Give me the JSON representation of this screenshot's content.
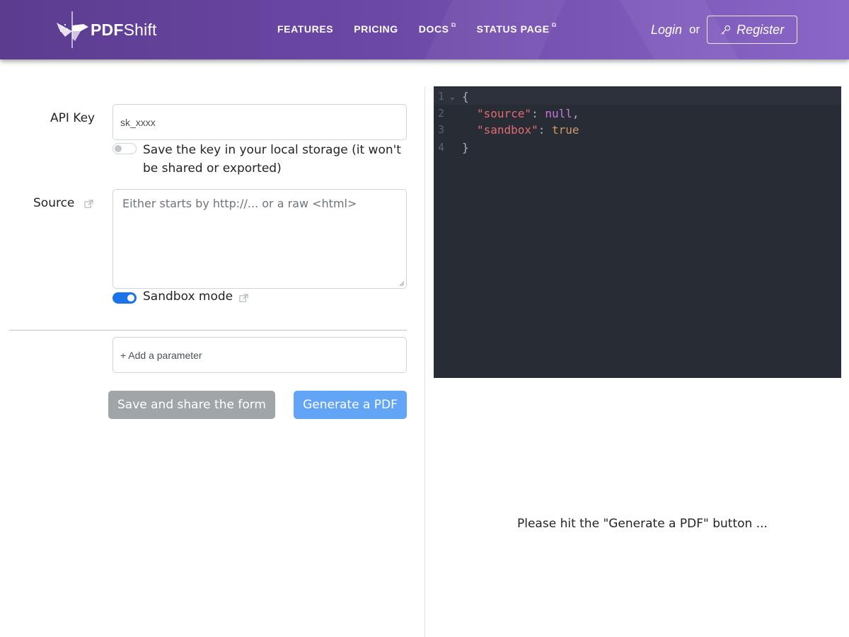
{
  "brand": {
    "name_bold": "PDF",
    "name_rest": "Shift"
  },
  "nav": [
    {
      "label": "FEATURES",
      "external": false
    },
    {
      "label": "PRICING",
      "external": false
    },
    {
      "label": "DOCS",
      "external": true
    },
    {
      "label": "STATUS PAGE",
      "external": true
    }
  ],
  "auth": {
    "login": "Login",
    "or": "or",
    "register": "Register"
  },
  "form": {
    "api_key": {
      "label": "API Key",
      "placeholder": "sk_xxxx",
      "value": "",
      "save_toggle_on": false,
      "save_text": "Save the key in your local storage (it won't be shared or exported)"
    },
    "source": {
      "label": "Source",
      "placeholder": "Either starts by http://... or a raw <html>",
      "value": ""
    },
    "sandbox": {
      "label": "Sandbox mode",
      "on": true
    },
    "add_param": {
      "placeholder": "+ Add a parameter"
    },
    "buttons": {
      "save_share": "Save and share the form",
      "generate": "Generate a PDF"
    }
  },
  "editor": {
    "line_numbers": [
      "1",
      "2",
      "3",
      "4"
    ],
    "lines": {
      "open": "{",
      "source_key": "\"source\"",
      "source_val": "null",
      "sandbox_key": "\"sandbox\"",
      "sandbox_val": "true",
      "close": "}",
      "colon": ": ",
      "comma": ","
    }
  },
  "preview": {
    "message": "Please hit the \"Generate a PDF\" button ..."
  },
  "colors": {
    "header_start": "#5b3c8f",
    "header_end": "#8a66c8",
    "primary_toggle": "#1a73e8",
    "generate_button": "#62a4f5",
    "save_button": "#a0a5aa",
    "editor_bg": "#282c34"
  }
}
